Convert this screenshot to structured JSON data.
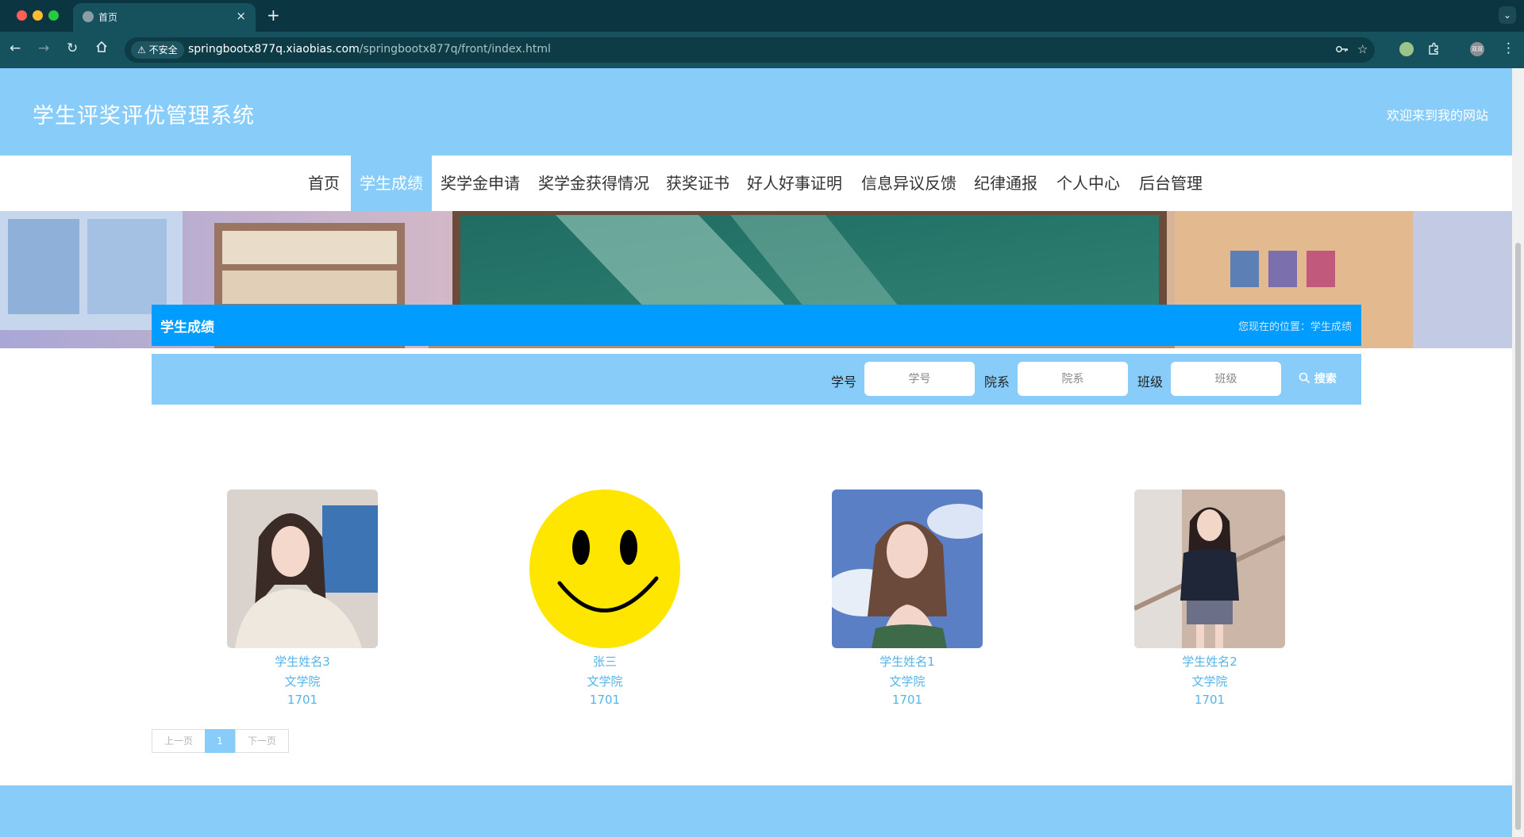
{
  "browser": {
    "tab_title": "首页",
    "tab_close": "×",
    "new_tab": "+",
    "security_label": "不安全",
    "url_host": "springbootx877q.xiaobias.com",
    "url_path": "/springbootx877q/front/index.html",
    "profile_label": "双双"
  },
  "header": {
    "site_title": "学生评奖评优管理系统",
    "welcome": "欢迎来到我的网站"
  },
  "nav": {
    "items": [
      "首页",
      "学生成绩",
      "奖学金申请",
      "奖学金获得情况",
      "获奖证书",
      "好人好事证明",
      "信息异议反馈",
      "纪律通报",
      "个人中心",
      "后台管理"
    ],
    "active": "学生成绩"
  },
  "banner": {
    "slide_count": 3,
    "active_slide": 1
  },
  "section": {
    "title": "学生成绩",
    "breadcrumb": "您现在的位置：学生成绩"
  },
  "search": {
    "student_id_label": "学号",
    "student_id_placeholder": "学号",
    "department_label": "院系",
    "department_placeholder": "院系",
    "class_label": "班级",
    "class_placeholder": "班级",
    "search_button": "搜索"
  },
  "students": [
    {
      "name": "学生姓名3",
      "department": "文学院",
      "class": "1701",
      "photo": "portrait-woman-white-coat"
    },
    {
      "name": "张三",
      "department": "文学院",
      "class": "1701",
      "photo": "yellow-smiley-face"
    },
    {
      "name": "学生姓名1",
      "department": "文学院",
      "class": "1701",
      "photo": "portrait-woman-sky"
    },
    {
      "name": "学生姓名2",
      "department": "文学院",
      "class": "1701",
      "photo": "portrait-student-uniform"
    }
  ],
  "pagination": {
    "prev": "上一页",
    "current": "1",
    "next": "下一页"
  },
  "colors": {
    "header_bg": "#88cdf9",
    "section_bar_bg": "#009cff",
    "link_text": "#55b4ea"
  }
}
